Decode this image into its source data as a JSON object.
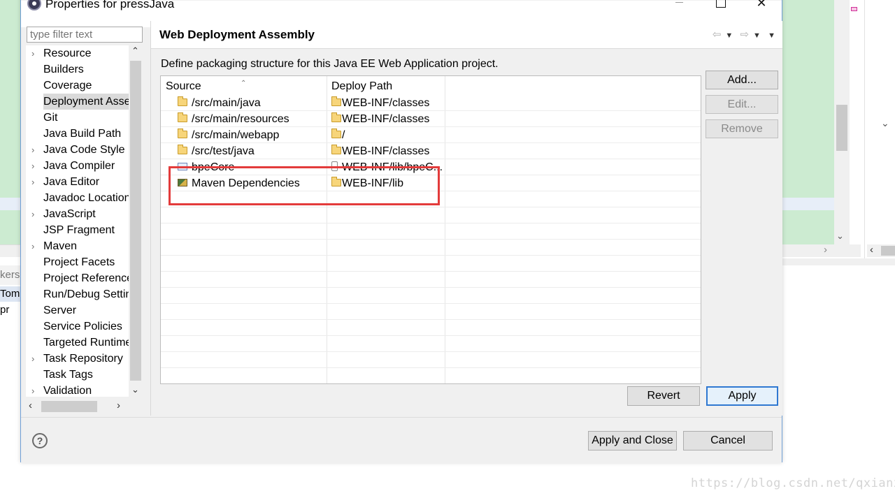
{
  "window": {
    "title": "Properties for pressJava"
  },
  "filter": {
    "placeholder": "type filter text"
  },
  "tree": {
    "items": [
      {
        "label": "Resource",
        "expandable": true
      },
      {
        "label": "Builders",
        "expandable": false
      },
      {
        "label": "Coverage",
        "expandable": false
      },
      {
        "label": "Deployment Assembly",
        "expandable": false,
        "selected": true
      },
      {
        "label": "Git",
        "expandable": false
      },
      {
        "label": "Java Build Path",
        "expandable": false
      },
      {
        "label": "Java Code Style",
        "expandable": true
      },
      {
        "label": "Java Compiler",
        "expandable": true
      },
      {
        "label": "Java Editor",
        "expandable": true
      },
      {
        "label": "Javadoc Location",
        "expandable": false
      },
      {
        "label": "JavaScript",
        "expandable": true
      },
      {
        "label": "JSP Fragment",
        "expandable": false
      },
      {
        "label": "Maven",
        "expandable": true
      },
      {
        "label": "Project Facets",
        "expandable": false
      },
      {
        "label": "Project References",
        "expandable": false
      },
      {
        "label": "Run/Debug Settings",
        "expandable": false
      },
      {
        "label": "Server",
        "expandable": false
      },
      {
        "label": "Service Policies",
        "expandable": false
      },
      {
        "label": "Targeted Runtimes",
        "expandable": false
      },
      {
        "label": "Task Repository",
        "expandable": true
      },
      {
        "label": "Task Tags",
        "expandable": false
      },
      {
        "label": "Validation",
        "expandable": true
      }
    ]
  },
  "page": {
    "title": "Web Deployment Assembly",
    "description": "Define packaging structure for this Java EE Web Application project.",
    "columns": {
      "source": "Source",
      "deploy_path": "Deploy Path"
    },
    "rows": [
      {
        "source": "/src/main/java",
        "source_icon": "folder-icon",
        "deploy": "WEB-INF/classes"
      },
      {
        "source": "/src/main/resources",
        "source_icon": "folder-icon",
        "deploy": "WEB-INF/classes"
      },
      {
        "source": "/src/main/webapp",
        "source_icon": "folder-icon",
        "deploy": "/"
      },
      {
        "source": "/src/test/java",
        "source_icon": "folder-icon",
        "deploy": "WEB-INF/classes"
      },
      {
        "source": "bpeCore",
        "source_icon": "project-icon",
        "deploy": "WEB-INF/lib/bpeC..."
      },
      {
        "source": "Maven Dependencies",
        "source_icon": "maven-library-icon",
        "deploy": "WEB-INF/lib"
      }
    ]
  },
  "buttons": {
    "add": "Add...",
    "edit": "Edit...",
    "remove": "Remove",
    "revert": "Revert",
    "apply": "Apply",
    "apply_and_close": "Apply and Close",
    "cancel": "Cancel"
  },
  "background": {
    "left_tab_fragment": "kers",
    "left_item_fragment": "Tomc",
    "left_project_fragment": "pr"
  },
  "watermark": "https://blog.csdn.net/qxianx",
  "colors": {
    "annotation": "#e33b3b",
    "default_button_border": "#2f78d1",
    "editor_background": "#ccebd1"
  }
}
